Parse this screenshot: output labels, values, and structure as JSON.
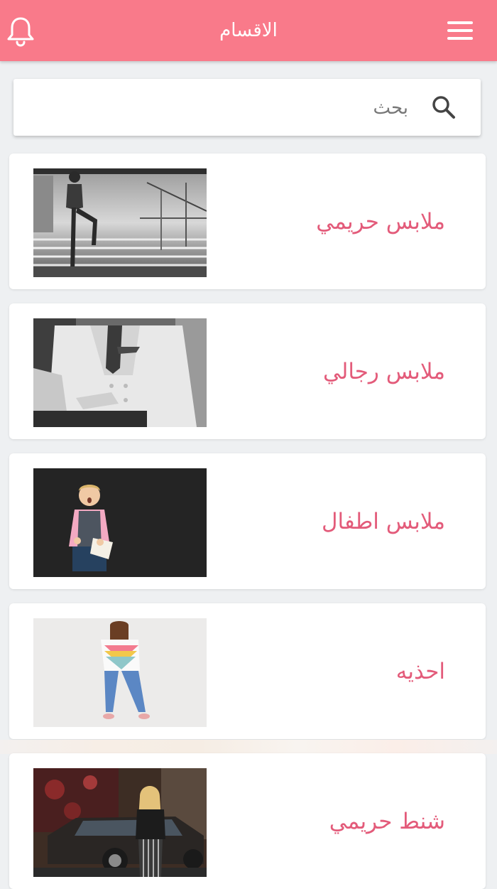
{
  "header": {
    "title": "الاقسام",
    "bell_icon": "bell-icon",
    "menu_icon": "hamburger-menu-icon",
    "background_color": "#f97a8a"
  },
  "search": {
    "placeholder": "بحث",
    "icon": "search-icon"
  },
  "categories": [
    {
      "label": "ملابس حريمي"
    },
    {
      "label": "ملابس رجالي"
    },
    {
      "label": "ملابس اطفال"
    },
    {
      "label": "احذيه"
    },
    {
      "label": "شنط حريمي"
    }
  ],
  "colors": {
    "accent": "#f97a8a",
    "category_text": "#e35b7a",
    "background": "#eef0f2"
  }
}
